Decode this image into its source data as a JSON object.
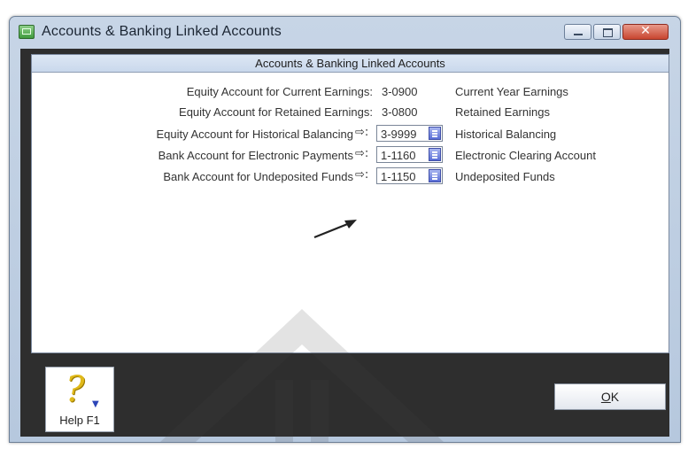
{
  "window": {
    "title": "Accounts & Banking Linked Accounts",
    "close_glyph": "✕"
  },
  "panel": {
    "header": "Accounts & Banking Linked Accounts"
  },
  "rows": [
    {
      "label": "Equity Account for Current Earnings:",
      "code": "3-0900",
      "description": "Current Year Earnings"
    },
    {
      "label": "Equity Account for Retained Earnings:",
      "code": "3-0800",
      "description": "Retained Earnings"
    },
    {
      "label": "Equity Account for Historical Balancing",
      "arrow": "⇨:",
      "code": "3-9999",
      "description": "Historical Balancing"
    },
    {
      "label": "Bank Account for Electronic Payments",
      "arrow": "⇨:",
      "code": "1-1160",
      "description": "Electronic Clearing Account"
    },
    {
      "label": "Bank Account for Undeposited Funds",
      "arrow": "⇨:",
      "code": "1-1150",
      "description": "Undeposited Funds"
    }
  ],
  "help": {
    "glyph": "?",
    "caret": "▼",
    "label": "Help F1"
  },
  "ok": {
    "label_underlined": "O",
    "label_rest": "K"
  }
}
